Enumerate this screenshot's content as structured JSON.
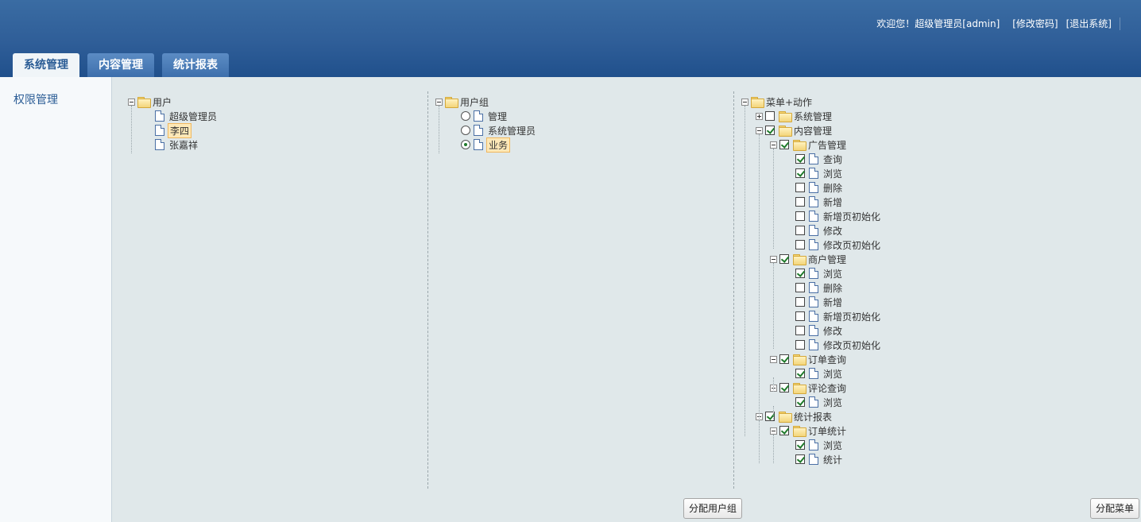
{
  "header": {
    "welcome": "欢迎您！超级管理员[admin]",
    "change_password": "[修改密码]",
    "logout": "[退出系统]"
  },
  "tabs": [
    {
      "label": "系统管理",
      "active": true
    },
    {
      "label": "内容管理",
      "active": false
    },
    {
      "label": "统计报表",
      "active": false
    }
  ],
  "sidebar": {
    "items": [
      {
        "label": "权限管理"
      }
    ]
  },
  "users_tree": {
    "root": "用户",
    "items": [
      "超级管理员",
      "李四",
      "张嘉祥"
    ],
    "selected": "李四"
  },
  "groups_tree": {
    "root": "用户组",
    "items": [
      "管理",
      "系统管理员",
      "业务"
    ],
    "selected": "业务"
  },
  "menu_tree": {
    "root": "菜单+动作",
    "nodes": [
      {
        "label": "系统管理",
        "checked": false,
        "expanded": false
      },
      {
        "label": "内容管理",
        "checked": true,
        "expanded": true
      },
      {
        "label": "广告管理",
        "checked": true,
        "expanded": true
      },
      {
        "label": "查询",
        "checked": true
      },
      {
        "label": "浏览",
        "checked": true
      },
      {
        "label": "删除",
        "checked": false
      },
      {
        "label": "新增",
        "checked": false
      },
      {
        "label": "新增页初始化",
        "checked": false
      },
      {
        "label": "修改",
        "checked": false
      },
      {
        "label": "修改页初始化",
        "checked": false
      },
      {
        "label": "商户管理",
        "checked": true,
        "expanded": true
      },
      {
        "label": "浏览",
        "checked": true
      },
      {
        "label": "删除",
        "checked": false
      },
      {
        "label": "新增",
        "checked": false
      },
      {
        "label": "新增页初始化",
        "checked": false
      },
      {
        "label": "修改",
        "checked": false
      },
      {
        "label": "修改页初始化",
        "checked": false
      },
      {
        "label": "订单查询",
        "checked": true,
        "expanded": true
      },
      {
        "label": "浏览",
        "checked": true
      },
      {
        "label": "评论查询",
        "checked": true,
        "expanded": true
      },
      {
        "label": "浏览",
        "checked": true
      },
      {
        "label": "统计报表",
        "checked": true,
        "expanded": true
      },
      {
        "label": "订单统计",
        "checked": true,
        "expanded": true
      },
      {
        "label": "浏览",
        "checked": true
      },
      {
        "label": "统计",
        "checked": true
      }
    ]
  },
  "buttons": {
    "assign_group": "分配用户组",
    "assign_menu": "分配菜单"
  }
}
